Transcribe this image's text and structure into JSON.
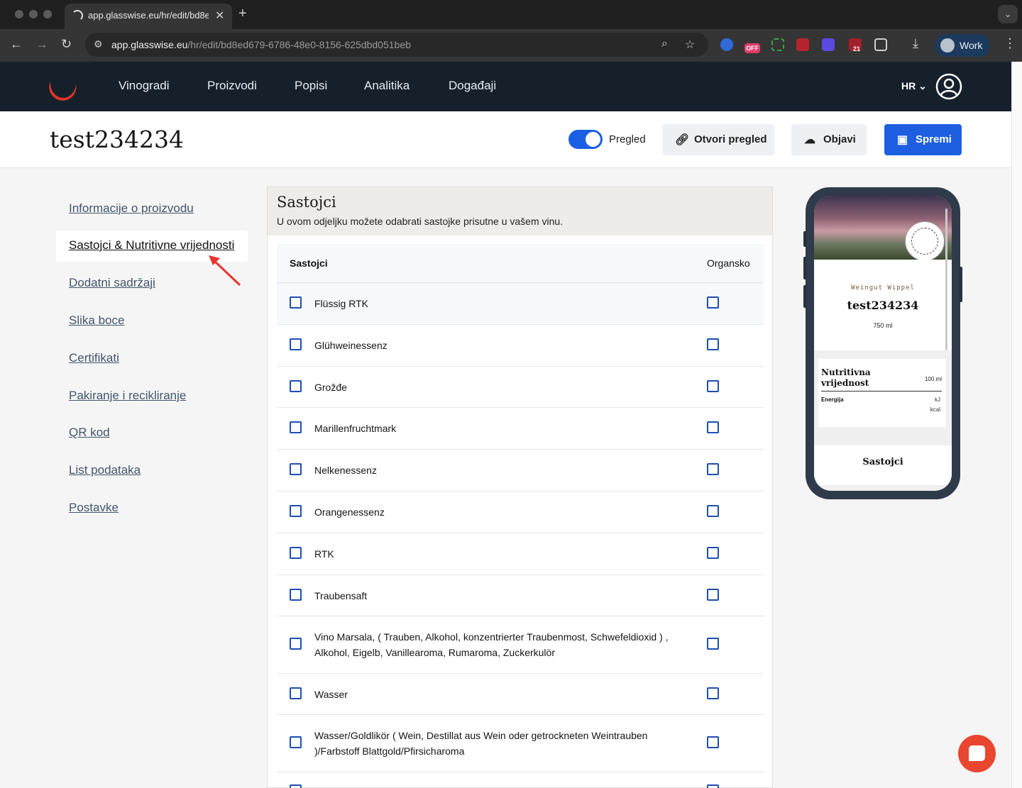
{
  "browser": {
    "tab_title": "app.glasswise.eu/hr/edit/bd8ed",
    "url_host": "app.glasswise.eu",
    "url_path": "/hr/edit/bd8ed679-6786-48e0-8156-625dbd051beb",
    "profile_label": "Work",
    "ext_badge_off": "OFF",
    "ext_badge_count": "21"
  },
  "nav": {
    "items": [
      "Vinogradi",
      "Proizvodi",
      "Popisi",
      "Analitika",
      "Događaji"
    ],
    "lang": "HR"
  },
  "page": {
    "title": "test234234",
    "toggle_label": "Pregled",
    "toggle_on": true,
    "open_preview_label": "Otvori pregled",
    "publish_label": "Objavi",
    "save_label": "Spremi",
    "accent": "#1d5fe0"
  },
  "sidebar": {
    "active": "Sastojci & Nutritivne vrijednosti",
    "items": [
      "Informacije o proizvodu",
      "Dodatni sadržaji",
      "Slika boce",
      "Certifikati",
      "Pakiranje i recikliranje",
      "QR kod",
      "List podataka",
      "Postavke"
    ]
  },
  "card": {
    "title": "Sastojci",
    "subtitle": "U ovom odjeljku možete odabrati sastojke prisutne u vašem vinu.",
    "col_ingredient": "Sastojci",
    "col_organic": "Organsko",
    "rows": [
      "Flüssig RTK",
      "Glühweinessenz",
      "Grožđe",
      "Marillenfruchtmark",
      "Nelkenessenz",
      "Orangenessenz",
      "RTK",
      "Traubensaft",
      "Vino Marsala, ( Trauben, Alkohol, konzentrierter Traubenmost, Schwefeldioxid ) , Alkohol, Eigelb, Vanillearoma, Rumaroma, Zuckerkulör",
      "Wasser",
      "Wasser/Goldlikör ( Wein, Destillat aus Wein oder getrockneten Weintrauben )/Farbstoff Blattgold/Pfirsicharoma"
    ]
  },
  "preview": {
    "winery": "Weingut Wippel",
    "title": "test234234",
    "volume": "750 ml",
    "nutrition_title": "Nutritivna vrijednost",
    "per": "100 ml",
    "energy_label": "Energija",
    "unit_kj": "kJ",
    "unit_kcal": "kcal",
    "ingredients_label": "Sastojci"
  }
}
